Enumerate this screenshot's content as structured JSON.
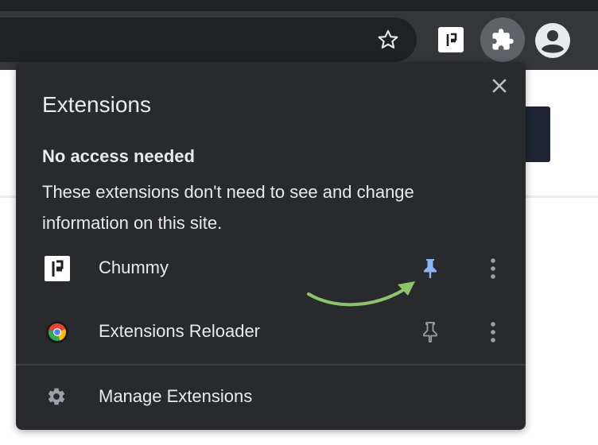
{
  "browser": {
    "toolbar_icons": [
      "star-icon",
      "chummy-extension-icon",
      "puzzle-icon",
      "account-icon"
    ]
  },
  "popup": {
    "title": "Extensions",
    "section_heading": "No access needed",
    "section_desc": "These extensions don't need to see and change information on this site.",
    "extensions": [
      {
        "name": "Chummy",
        "icon": "chummy-icon",
        "pinned": true,
        "pin_color": "#8ab4f8"
      },
      {
        "name": "Extensions Reloader",
        "icon": "reloader-icon",
        "pinned": false,
        "pin_color": "#9aa0a6"
      }
    ],
    "manage_label": "Manage Extensions"
  },
  "colors": {
    "panel_bg": "#292a2d",
    "text": "#e8eaed",
    "pin_active": "#8ab4f8",
    "arrow": "#8fc46a"
  }
}
